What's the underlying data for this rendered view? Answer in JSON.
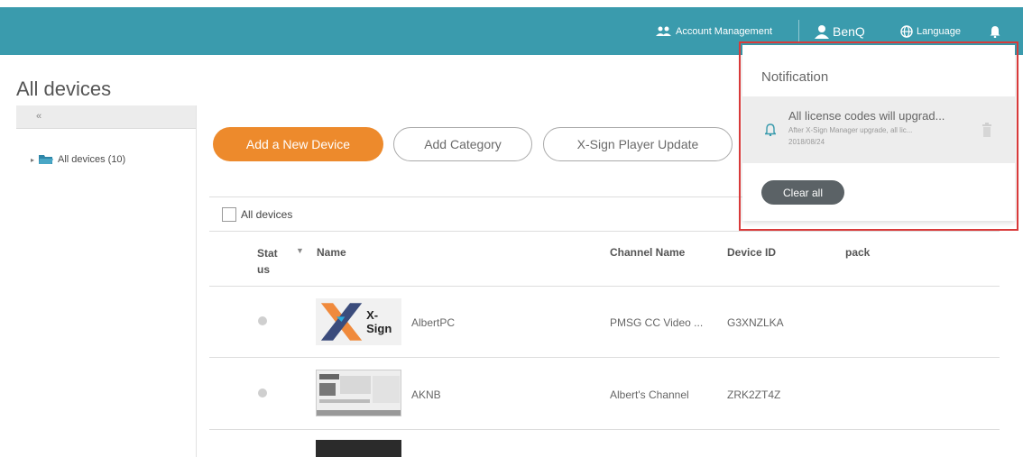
{
  "header": {
    "account_label": "Account Management",
    "user_label": "BenQ",
    "language_label": "Language"
  },
  "page": {
    "title": "All devices"
  },
  "sidebar": {
    "collapse_label": "«",
    "tree_label": "All devices (10)"
  },
  "toolbar": {
    "add_device": "Add a New Device",
    "add_category": "Add Category",
    "player_update": "X-Sign Player Update"
  },
  "table": {
    "select_all_label": "All devices",
    "headers": {
      "status_1": "Stat",
      "status_2": "us",
      "name": "Name",
      "channel": "Channel Name",
      "device_id": "Device ID",
      "pack": "pack"
    },
    "rows": [
      {
        "thumb_text": "X-Sign",
        "name": "AlbertPC",
        "channel": "PMSG CC Video ...",
        "device_id": "G3XNZLKA"
      },
      {
        "name": "AKNB",
        "channel": "Albert's Channel",
        "device_id": "ZRK2ZT4Z"
      }
    ]
  },
  "notification": {
    "title": "Notification",
    "item": {
      "headline": "All license codes will upgrad...",
      "subtext": "After X-Sign Manager upgrade, all lic...",
      "date": "2018/08/24"
    },
    "clear_label": "Clear all"
  },
  "colors": {
    "topbar": "#3a9bad",
    "primary_button": "#ed8a2c",
    "highlight_frame": "#d93a3a",
    "clear_button": "#5b6266"
  },
  "icons": [
    "users-icon",
    "user-icon",
    "globe-icon",
    "bell-icon",
    "folder-icon",
    "trash-icon",
    "sort-icon"
  ]
}
